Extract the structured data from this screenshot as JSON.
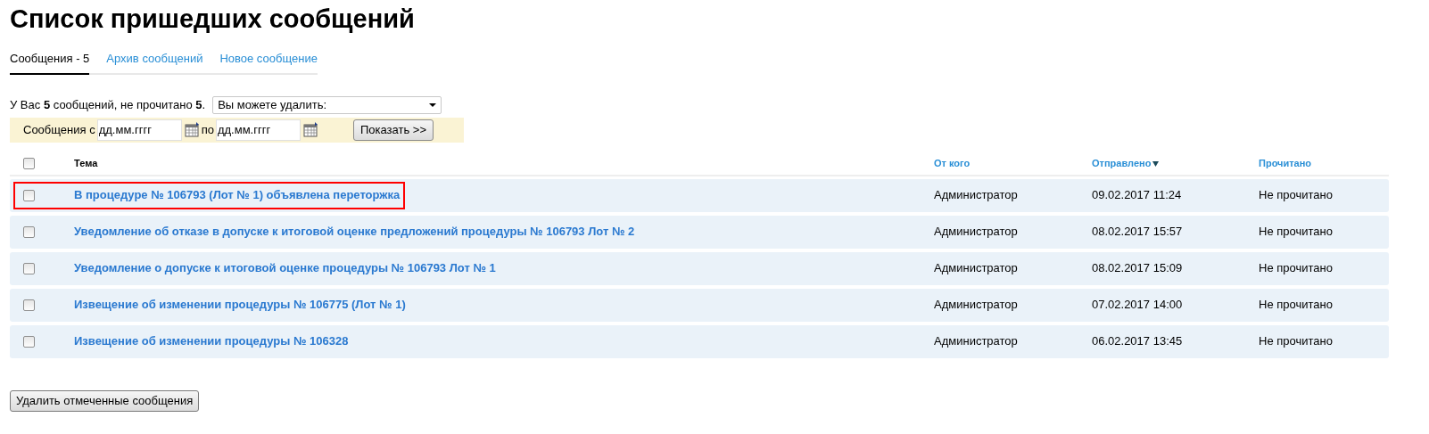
{
  "title": "Список пришедших сообщений",
  "tabs": [
    {
      "label": "Сообщения - 5",
      "selected": true
    },
    {
      "label": "Архив сообщений",
      "selected": false
    },
    {
      "label": "Новое сообщение",
      "selected": false
    }
  ],
  "summary": "У Вас **5** сообщений, не прочитано **5**.",
  "delete_select": {
    "value": "Вы можете удалить:"
  },
  "filter": {
    "from_label": "Сообщения с",
    "from_placeholder": "дд.мм.гггг",
    "to_label": "по",
    "to_placeholder": "дд.мм.гггг",
    "button": "Показать >>"
  },
  "table": {
    "select_all_checked": false,
    "columns": [
      {
        "label": "Тема",
        "link": false,
        "sorted": false
      },
      {
        "label": "От кого",
        "link": true,
        "sorted": false
      },
      {
        "label": "Отправлено",
        "link": true,
        "sorted": true
      },
      {
        "label": "Прочитано",
        "link": true,
        "sorted": false
      }
    ],
    "rows": [
      {
        "checked": false,
        "highlighted": true,
        "subject": "В процедуре № 106793 (Лот № 1) объявлена переторжка",
        "from": "Администратор",
        "sent": "09.02.2017 11:24",
        "read": "Не прочитано"
      },
      {
        "checked": false,
        "highlighted": false,
        "subject": "Уведомление об отказе в допуске к итоговой оценке предложений процедуры № 106793 Лот № 2",
        "from": "Администратор",
        "sent": "08.02.2017 15:57",
        "read": "Не прочитано"
      },
      {
        "checked": false,
        "highlighted": false,
        "subject": "Уведомление о допуске к итоговой оценке процедуры № 106793 Лот № 1",
        "from": "Администратор",
        "sent": "08.02.2017 15:09",
        "read": "Не прочитано"
      },
      {
        "checked": false,
        "highlighted": false,
        "subject": "Извещение об изменении процедуры № 106775 (Лот № 1)",
        "from": "Администратор",
        "sent": "07.02.2017 14:00",
        "read": "Не прочитано"
      },
      {
        "checked": false,
        "highlighted": false,
        "subject": "Извещение об изменении процедуры № 106328",
        "from": "Администратор",
        "sent": "06.02.2017 13:45",
        "read": "Не прочитано"
      }
    ]
  },
  "delete_button": "Удалить отмеченные сообщения"
}
